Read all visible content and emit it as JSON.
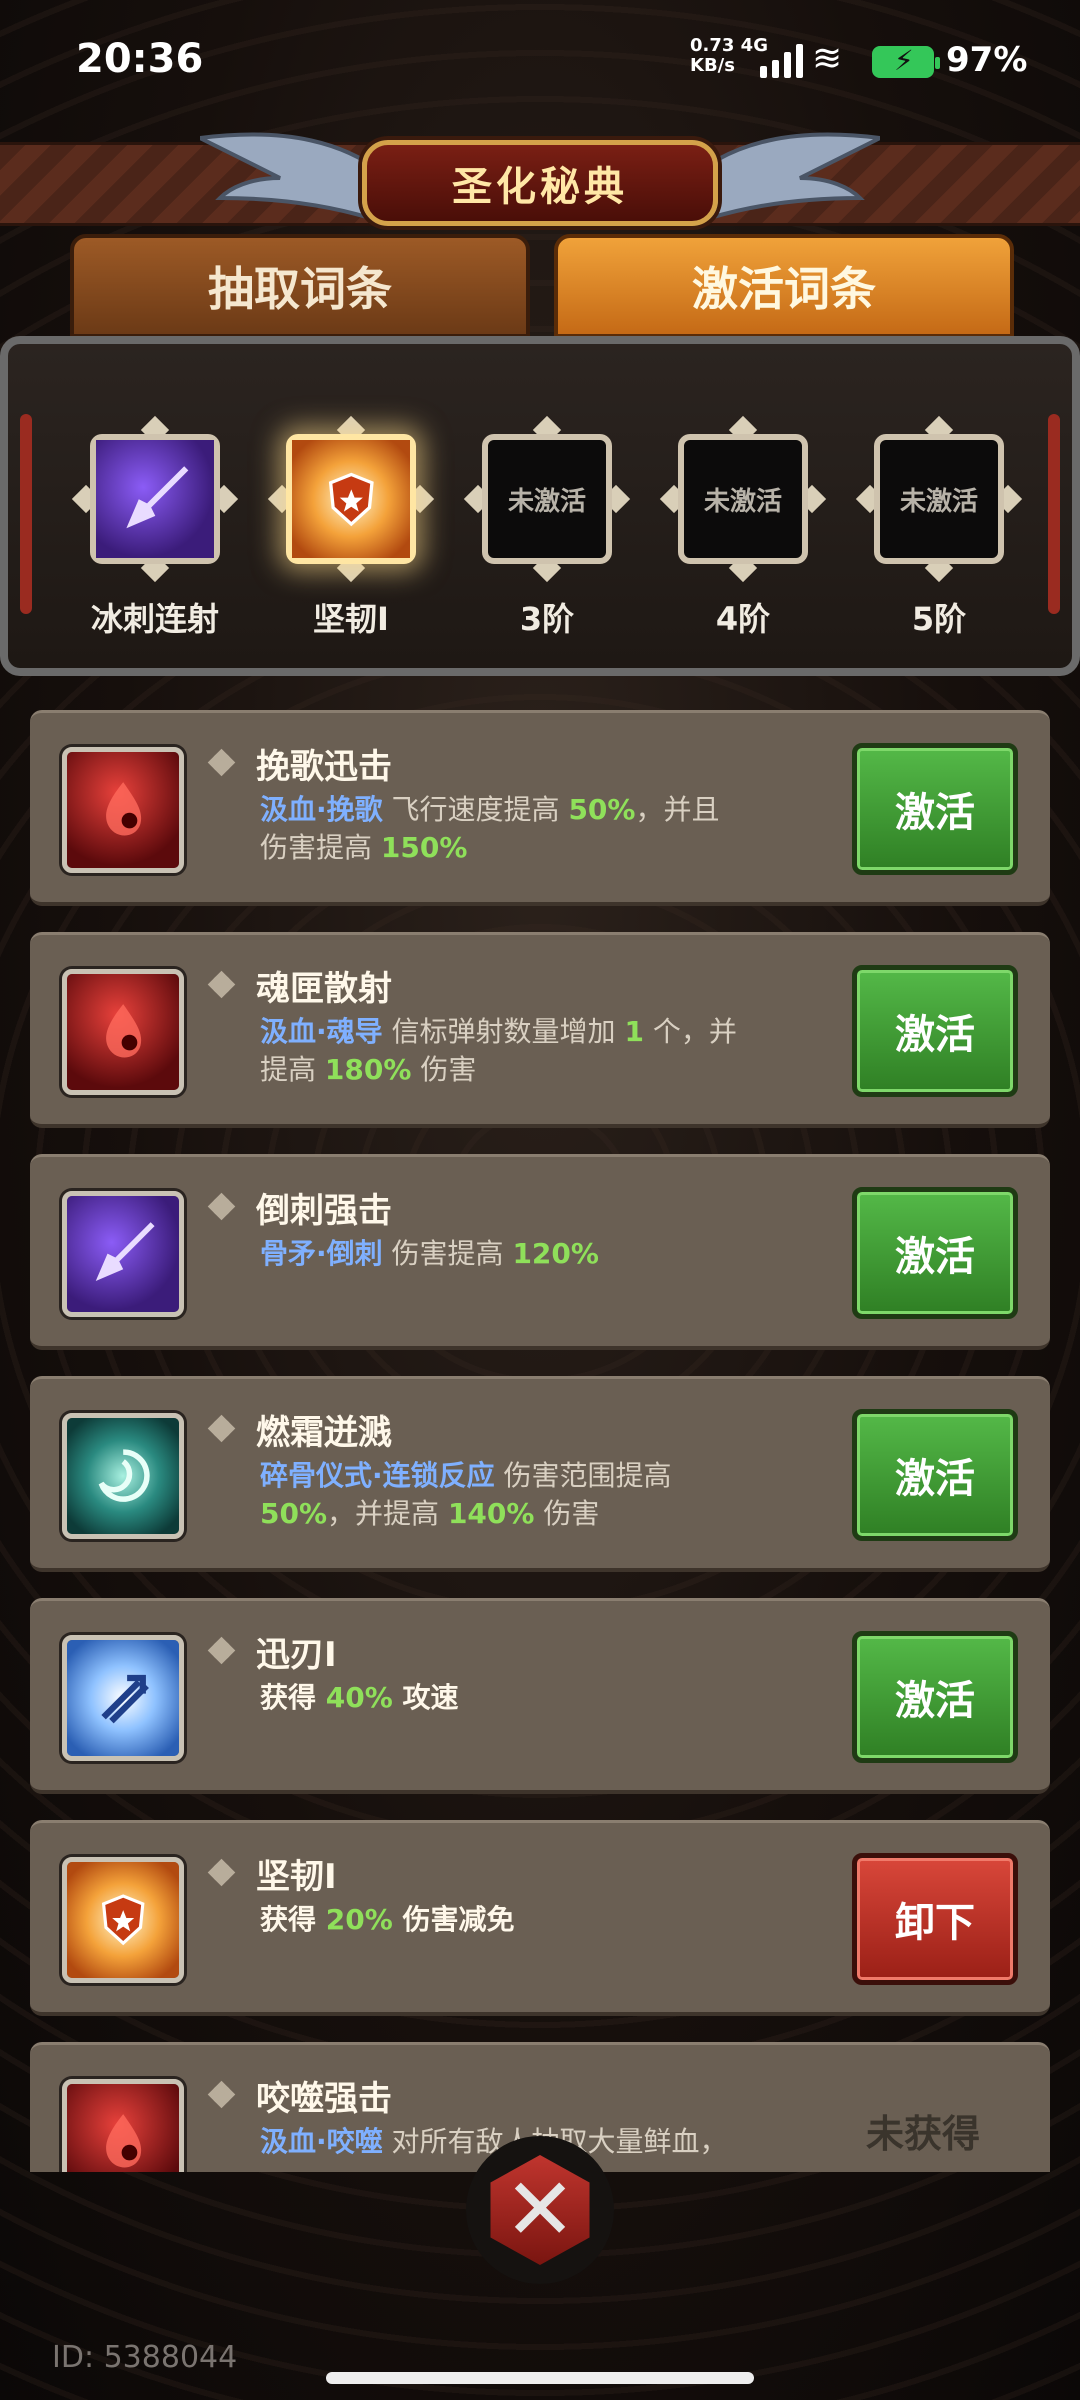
{
  "status": {
    "time": "20:36",
    "net_top": "0.73 4G",
    "net_bottom": "KB/s",
    "battery": "97%"
  },
  "header": {
    "title": "圣化秘典"
  },
  "tabs": {
    "extract": "抽取词条",
    "activate": "激活词条"
  },
  "slots": [
    {
      "label": "冰刺连射",
      "icon": "purple-spear-icon",
      "state": "filled"
    },
    {
      "label": "坚韧I",
      "icon": "shield-burst-icon",
      "state": "selected"
    },
    {
      "label": "3阶",
      "inner": "未激活",
      "state": "empty"
    },
    {
      "label": "4阶",
      "inner": "未激活",
      "state": "empty"
    },
    {
      "label": "5阶",
      "inner": "未激活",
      "state": "empty"
    }
  ],
  "entries": [
    {
      "name": "挽歌迅击",
      "icon": "blood-drop-icon",
      "tag": "汲血·挽歌",
      "line1": "飞行速度提高 ",
      "n1": "50%",
      "line1b": "，并且",
      "line2": "伤害提高 ",
      "n2": "150%",
      "line2b": "",
      "button": "激活",
      "style": "green"
    },
    {
      "name": "魂匣散射",
      "icon": "blood-drop-icon",
      "tag": "汲血·魂导",
      "line1": "信标弹射数量增加 ",
      "n1": "1",
      "line1b": " 个，并",
      "line2": "提高 ",
      "n2": "180%",
      "line2b": " 伤害",
      "button": "激活",
      "style": "green"
    },
    {
      "name": "倒刺强击",
      "icon": "purple-spear-icon",
      "tag": "骨矛·倒刺",
      "line1": "伤害提高 ",
      "n1": "120%",
      "line1b": "",
      "line2": "",
      "n2": "",
      "line2b": "",
      "button": "激活",
      "style": "green"
    },
    {
      "name": "燃霜迸溅",
      "icon": "vortex-icon",
      "tag": "碎骨仪式·连锁反应",
      "line1": "伤害范围提高",
      "n1": "",
      "line1b": "",
      "line2": "",
      "n2": "50%",
      "line2b": "，并提高 ",
      "n3": "140%",
      "line2c": " 伤害",
      "button": "激活",
      "style": "green"
    },
    {
      "name": "迅刃I",
      "icon": "blade-arrows-icon",
      "plain1": "获得 ",
      "n1": "40%",
      "plain2": " 攻速",
      "button": "激活",
      "style": "green"
    },
    {
      "name": "坚韧I",
      "icon": "shield-burst-icon",
      "plain1": "获得 ",
      "n1": "20%",
      "plain2": " 伤害减免",
      "button": "卸下",
      "style": "red"
    },
    {
      "name": "咬噬强击",
      "icon": "blood-drop-icon",
      "tag": "汲血·咬噬",
      "line1": "对所有敌人抽取大量鲜血，",
      "status": "未获得"
    }
  ],
  "footer": {
    "id": "ID: 5388044"
  },
  "colors": {
    "tag": "#7fb0ff",
    "number": "#8fe05a",
    "activate": "#3f9a33",
    "unequip": "#b8302a"
  }
}
